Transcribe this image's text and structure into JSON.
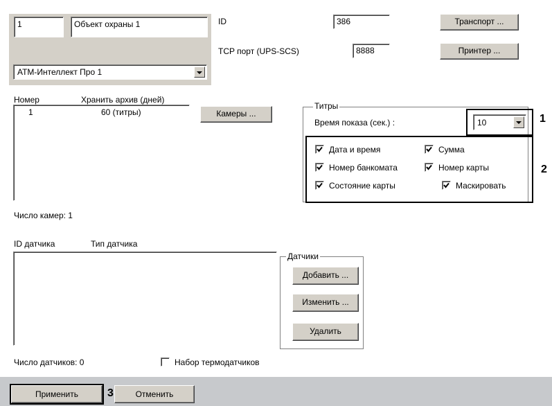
{
  "object": {
    "id_value": "1",
    "name_value": "Объект охраны 1",
    "parent_value": "АТМ-Интеллект Про 1"
  },
  "params": {
    "id_label": "ID",
    "id_value": "386",
    "tcp_label": "TCP порт (UPS-SCS)",
    "tcp_value": "8888",
    "transport_button": "Транспорт ...",
    "printer_button": "Принтер ..."
  },
  "cameras": {
    "col_number": "Номер",
    "col_archive": "Хранить архив (дней)",
    "rows": [
      {
        "number": "1",
        "archive": "60  (титры)"
      }
    ],
    "cameras_button": "Камеры ...",
    "count_label": "Число камер: 1"
  },
  "titles": {
    "group_title": "Титры",
    "show_time_label": "Время показа (сек.) :",
    "show_time_value": "10",
    "checkboxes": {
      "date_time": {
        "label": "Дата и время",
        "checked": true
      },
      "sum": {
        "label": "Сумма",
        "checked": true
      },
      "atm_number": {
        "label": "Номер банкомата",
        "checked": true
      },
      "card_number": {
        "label": "Номер карты",
        "checked": true
      },
      "card_state": {
        "label": "Состояние карты",
        "checked": true
      },
      "mask": {
        "label": "Маскировать",
        "checked": true
      }
    }
  },
  "sensors": {
    "col_id": "ID датчика",
    "col_type": "Тип датчика",
    "group_title": "Датчики",
    "add_button": "Добавить ...",
    "edit_button": "Изменить ...",
    "delete_button": "Удалить",
    "count_label": "Число датчиков: 0",
    "thermo_label": "Набор термодатчиков",
    "thermo_checked": false
  },
  "footer": {
    "apply_button": "Применить",
    "cancel_button": "Отменить"
  },
  "annotations": {
    "one": "1",
    "two": "2",
    "three": "3"
  }
}
